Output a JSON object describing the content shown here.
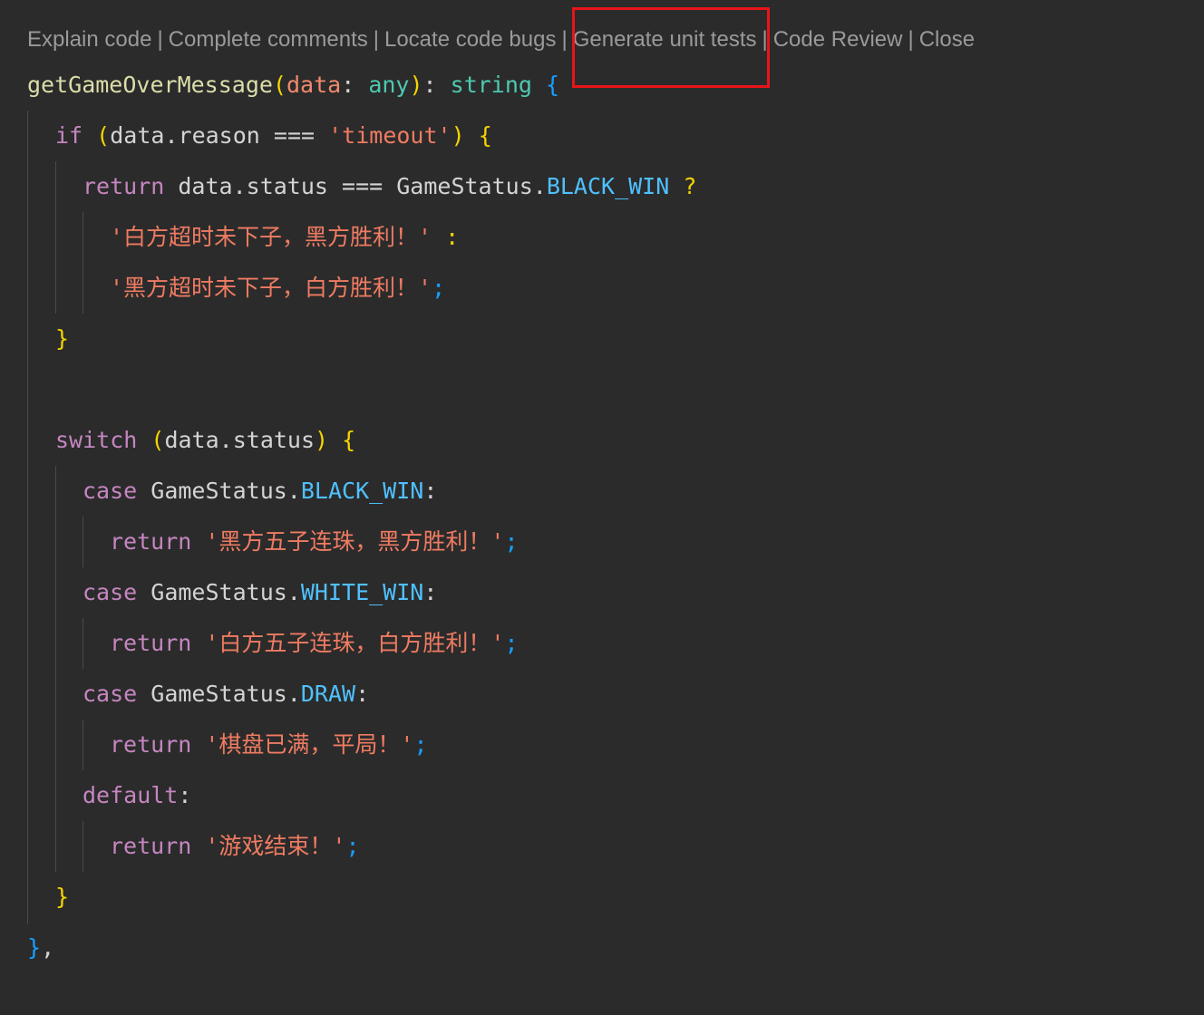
{
  "codelens": {
    "items": [
      "Explain code",
      "Complete comments",
      "Locate code bugs",
      "Generate unit tests",
      "Code Review",
      "Close"
    ],
    "separator": "|"
  },
  "code": {
    "fn_name": "getGameOverMessage",
    "param": "data",
    "param_type": "any",
    "return_type": "string",
    "if_kw": "if",
    "var_data": "data",
    "prop_reason": "reason",
    "op_strict_eq": "===",
    "str_timeout": "'timeout'",
    "return_kw": "return",
    "prop_status": "status",
    "enum_name": "GameStatus",
    "enum_black_win": "BLACK_WIN",
    "enum_white_win": "WHITE_WIN",
    "enum_draw": "DRAW",
    "ternary_q": "?",
    "ternary_colon": ":",
    "str_white_timeout": "'白方超时未下子，黑方胜利！'",
    "str_black_timeout": "'黑方超时未下子，白方胜利！'",
    "switch_kw": "switch",
    "case_kw": "case",
    "default_kw": "default",
    "str_black_win": "'黑方五子连珠，黑方胜利！'",
    "str_white_win": "'白方五子连珠，白方胜利！'",
    "str_draw": "'棋盘已满，平局！'",
    "str_default": "'游戏结束！'",
    "closing": "},"
  }
}
